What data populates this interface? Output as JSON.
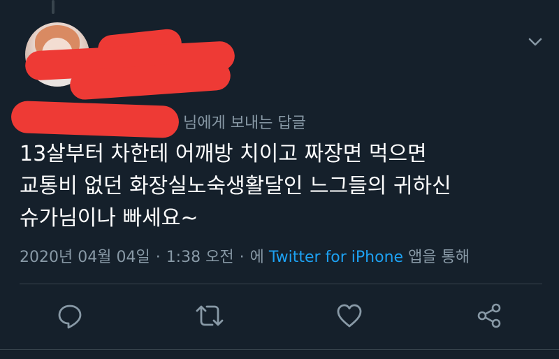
{
  "reply_context": {
    "suffix": "님에게 보내는 답글"
  },
  "tweet": {
    "text": "13살부터 차한테 어깨방 치이고 짜장면 먹으면\n교통비 없던 화장실노숙생활달인 느그들의 귀하신\n슈가님이나 빠세요~"
  },
  "meta": {
    "date": "2020년 04월 04일",
    "separator": "·",
    "time": "1:38 오전",
    "source_prefix": "에",
    "source": "Twitter for iPhone",
    "source_suffix": "앱을 통해"
  },
  "icons": {
    "menu": "chevron-down-icon",
    "reply": "reply-icon",
    "retweet": "retweet-icon",
    "like": "heart-icon",
    "share": "share-icon"
  },
  "colors": {
    "background": "#15202b",
    "secondary_text": "#8899a6",
    "link": "#1da1f2",
    "divider": "#38444d",
    "redaction": "#ee3a35"
  }
}
